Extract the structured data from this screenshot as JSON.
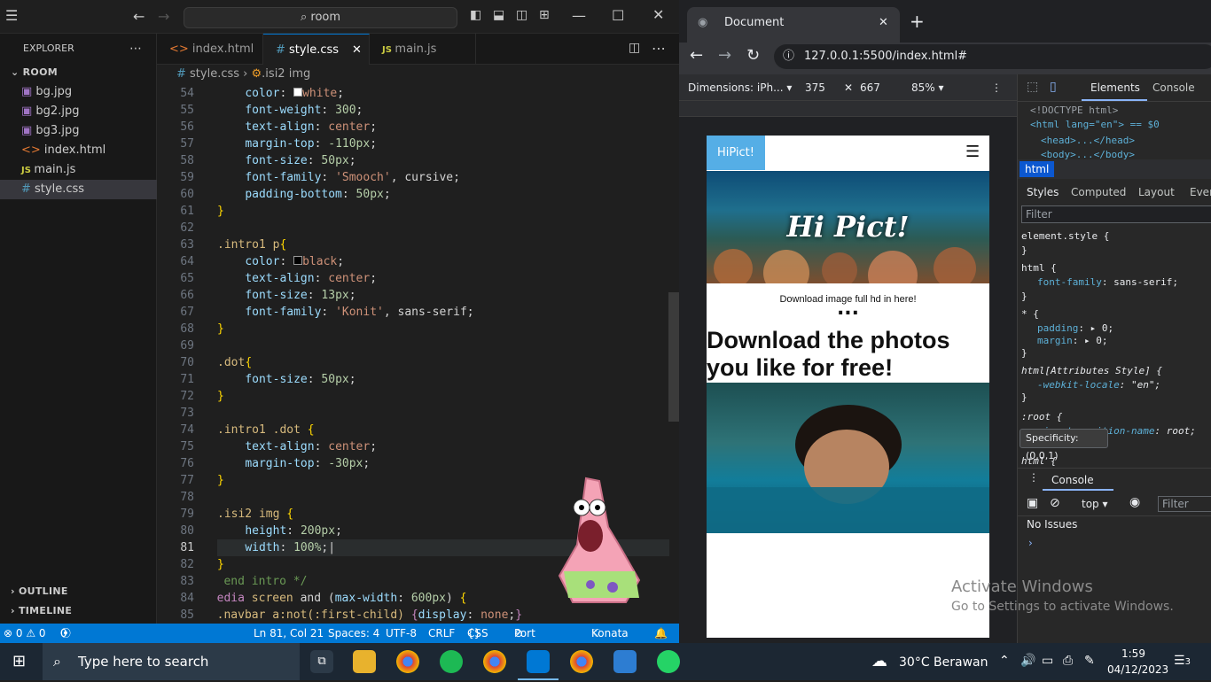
{
  "vscode": {
    "search_text": "room",
    "explorer_title": "EXPLORER",
    "folder": "ROOM",
    "files": [
      "bg.jpg",
      "bg2.jpg",
      "bg3.jpg",
      "index.html",
      "main.js",
      "style.css"
    ],
    "outline": "OUTLINE",
    "timeline": "TIMELINE",
    "tabs": [
      "index.html",
      "style.css",
      "main.js"
    ],
    "breadcrumb_file": "style.css",
    "breadcrumb_symbol": ".isi2 img",
    "line_numbers": [
      "54",
      "55",
      "56",
      "57",
      "58",
      "59",
      "60",
      "61",
      "62",
      "63",
      "64",
      "65",
      "66",
      "67",
      "68",
      "69",
      "70",
      "71",
      "72",
      "73",
      "74",
      "75",
      "76",
      "77",
      "78",
      "79",
      "80",
      "81",
      "82",
      "83",
      "84",
      "85"
    ],
    "status": {
      "problems": "⊗ 0 ⚠ 0",
      "ports": "0",
      "position": "Ln 81, Col 21",
      "spaces": "Spaces: 4",
      "encoding": "UTF-8",
      "eol": "CRLF",
      "language": "CSS",
      "port": "Port : 5500",
      "theme": "Konata"
    }
  },
  "browser": {
    "tab_title": "Document",
    "url": "127.0.0.1:5500/index.html#",
    "device": {
      "dimensions": "Dimensions: iPh...",
      "width": "375",
      "height": "667",
      "zoom": "85%"
    },
    "page": {
      "logo": "HiPict!",
      "hero_title": "Hi Pict!",
      "download_text": "Download image full hd in here!",
      "dots": "...",
      "headline": "Download the photos you like for free!"
    }
  },
  "devtools": {
    "tabs": [
      "Elements",
      "Console"
    ],
    "doctype": "<!DOCTYPE html>",
    "html_open": "<html lang=\"en\"> == $0",
    "head": "<head>...</head>",
    "body": "<body>...</body>",
    "crumb": "html",
    "style_tabs": [
      "Styles",
      "Computed",
      "Layout",
      "Event"
    ],
    "filter": "Filter",
    "tooltip": "Specificity: (0,0,1)",
    "console_tab": "Console",
    "console_context": "top",
    "console_filter": "Filter",
    "no_issues": "No Issues"
  },
  "watermark": {
    "line1": "Activate Windows",
    "line2": "Go to Settings to activate Windows."
  },
  "taskbar": {
    "search_placeholder": "Type here to search",
    "weather": "30°C  Berawan",
    "time": "1:59",
    "date": "04/12/2023",
    "notifications": "3"
  }
}
